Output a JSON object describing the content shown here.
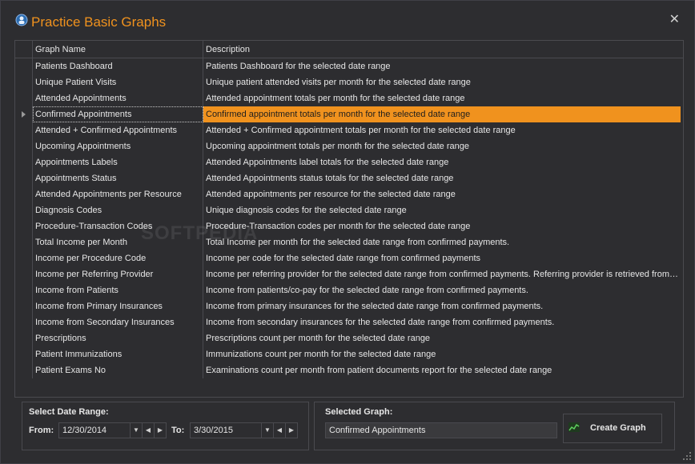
{
  "window": {
    "title": "Practice Basic Graphs",
    "close_glyph": "✕",
    "accent_color": "#f0921e"
  },
  "grid": {
    "columns": [
      "Graph Name",
      "Description"
    ],
    "selected_index": 3,
    "rows": [
      {
        "name": "Patients Dashboard",
        "desc": "Patients Dashboard for the selected date range"
      },
      {
        "name": "Unique Patient Visits",
        "desc": "Unique patient attended visits per month for the selected date range"
      },
      {
        "name": "Attended Appointments",
        "desc": "Attended appointment totals per month for the selected date range"
      },
      {
        "name": "Confirmed Appointments",
        "desc": "Confirmed appointment totals per month for the selected date range"
      },
      {
        "name": "Attended + Confirmed Appointments",
        "desc": "Attended + Confirmed appointment totals per month for the selected date range"
      },
      {
        "name": "Upcoming Appointments",
        "desc": "Upcoming appointment totals per month for the selected date range"
      },
      {
        "name": "Appointments Labels",
        "desc": "Attended Appointments label totals for the selected date range"
      },
      {
        "name": "Appointments Status",
        "desc": "Attended Appointments status totals for the selected date range"
      },
      {
        "name": "Attended Appointments per Resource",
        "desc": "Attended appointments per resource for the selected date range"
      },
      {
        "name": "Diagnosis Codes",
        "desc": "Unique diagnosis codes for the selected date range"
      },
      {
        "name": "Procedure-Transaction Codes",
        "desc": "Procedure-Transaction codes per month for the selected date range"
      },
      {
        "name": "Total Income per Month",
        "desc": "Total Income per month for the selected date range from confirmed payments."
      },
      {
        "name": "Income per Procedure Code",
        "desc": "Income per code for the selected date range from confirmed payments"
      },
      {
        "name": "Income per Referring Provider",
        "desc": "Income per referring provider for the selected date range from confirmed payments. Referring provider is retrieved from…"
      },
      {
        "name": "Income from Patients",
        "desc": "Income from patients/co-pay for the selected date range from confirmed payments."
      },
      {
        "name": "Income from Primary Insurances",
        "desc": "Income from primary insurances for the selected date range from confirmed payments."
      },
      {
        "name": "Income from Secondary Insurances",
        "desc": "Income from secondary insurances for the selected date range from confirmed payments."
      },
      {
        "name": "Prescriptions",
        "desc": "Prescriptions count per month for the selected date range"
      },
      {
        "name": "Patient Immunizations",
        "desc": "Immunizations count per month for the selected date range"
      },
      {
        "name": "Patient Exams No",
        "desc": "Examinations count per month from patient documents report for the selected date range"
      }
    ]
  },
  "watermark": "SOFTPEDIA",
  "date_range": {
    "title": "Select Date Range:",
    "from_label": "From:",
    "from_value": "12/30/2014",
    "to_label": "To:",
    "to_value": "3/30/2015",
    "dropdown_glyph": "▼",
    "prev_glyph": "◀",
    "next_glyph": "▶"
  },
  "selected_graph": {
    "title": "Selected Graph:",
    "value": "Confirmed Appointments",
    "create_label": "Create Graph"
  }
}
